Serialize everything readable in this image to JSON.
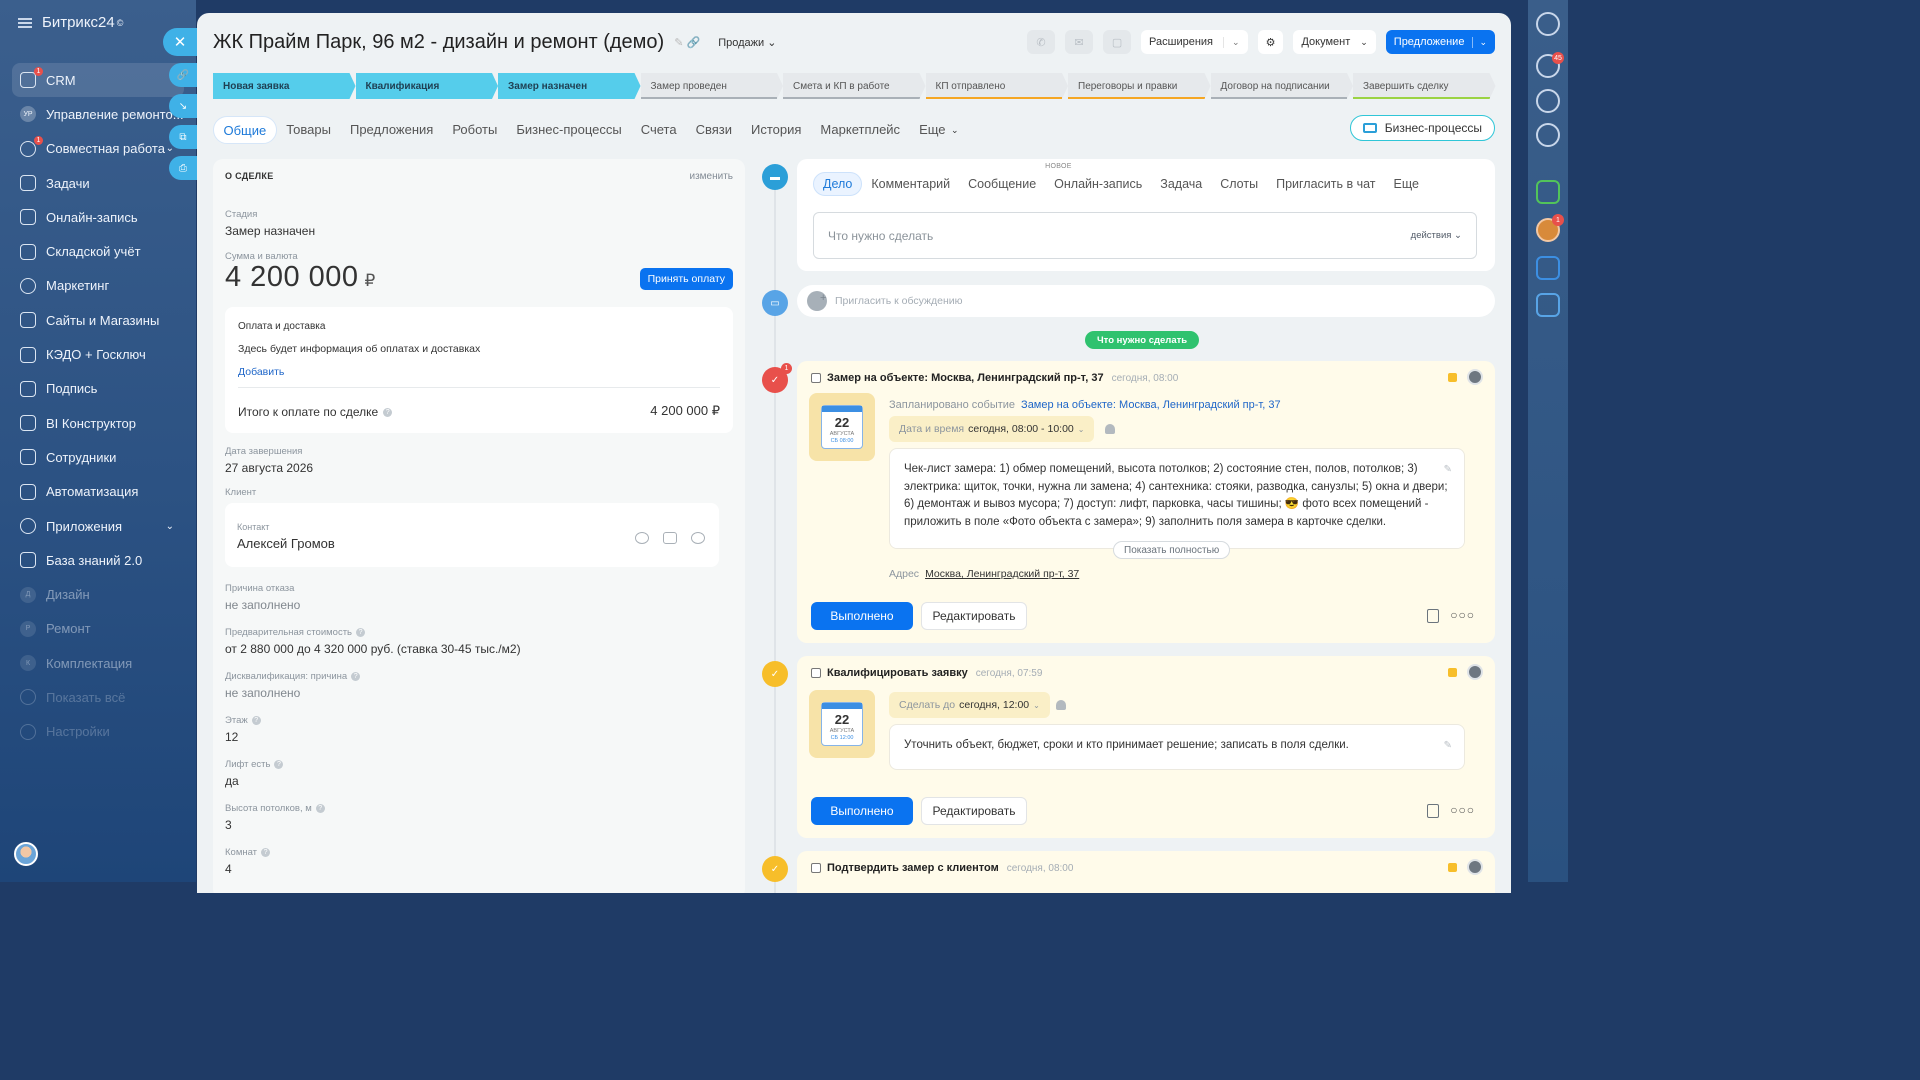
{
  "nav": {
    "brand": "Битрикс24",
    "brand_mark": "©",
    "items": [
      {
        "label": "CRM",
        "badge": "1"
      },
      {
        "label": "Управление ремонто..."
      },
      {
        "label": "Совместная работа",
        "badge": "1"
      },
      {
        "label": "Задачи"
      },
      {
        "label": "Онлайн-запись"
      },
      {
        "label": "Складской учёт"
      },
      {
        "label": "Маркетинг"
      },
      {
        "label": "Сайты и Магазины"
      },
      {
        "label": "КЭДО + Госключ"
      },
      {
        "label": "Подпись"
      },
      {
        "label": "BI Конструктор"
      },
      {
        "label": "Сотрудники"
      },
      {
        "label": "Автоматизация"
      },
      {
        "label": "Приложения"
      },
      {
        "label": "База знаний 2.0"
      },
      {
        "label": "Дизайн"
      },
      {
        "label": "Ремонт"
      },
      {
        "label": "Комплектация"
      },
      {
        "label": "Показать всё"
      },
      {
        "label": "Настройки"
      }
    ],
    "prefix_letters": [
      "УР",
      "Д",
      "Р",
      "К"
    ]
  },
  "right_badges": {
    "notifications": "45",
    "chat": "1"
  },
  "deal": {
    "title": "ЖК Прайм Парк, 96 м2 - дизайн и ремонт (демо)",
    "category": "Продажи",
    "tools": {
      "extensions": "Расширения",
      "document": "Документ",
      "proposal": "Предложение"
    }
  },
  "stages": [
    {
      "label": "Новая заявка",
      "state": "done"
    },
    {
      "label": "Квалификация",
      "state": "done"
    },
    {
      "label": "Замер назначен",
      "state": "done"
    },
    {
      "label": "Замер проведен",
      "state": "todo",
      "color": "#a9b0b7"
    },
    {
      "label": "Смета и КП в работе",
      "state": "todo",
      "color": "#a9b0b7"
    },
    {
      "label": "КП отправлено",
      "state": "todo",
      "color": "#f5a623"
    },
    {
      "label": "Переговоры и правки",
      "state": "todo",
      "color": "#f5a623"
    },
    {
      "label": "Договор на подписании",
      "state": "todo",
      "color": "#a9b0b7"
    },
    {
      "label": "Завершить сделку",
      "state": "todo",
      "color": "#9bd343"
    }
  ],
  "tabs": [
    "Общие",
    "Товары",
    "Предложения",
    "Роботы",
    "Бизнес-процессы",
    "Счета",
    "Связи",
    "История",
    "Маркетплейс",
    "Еще"
  ],
  "bp_button": "Бизнес-процессы",
  "about": {
    "header": "О СДЕЛКЕ",
    "edit": "изменить",
    "stage_label": "Стадия",
    "stage_value": "Замер назначен",
    "sum_label": "Сумма и валюта",
    "sum_value": "4 200 000",
    "currency": "₽",
    "pay_button": "Принять оплату",
    "payment": {
      "title": "Оплата и доставка",
      "desc": "Здесь будет информация об оплатах и доставках",
      "add": "Добавить",
      "total_label": "Итого к оплате по сделке",
      "total_value": "4 200 000 ₽"
    },
    "close_date_label": "Дата завершения",
    "close_date": "27 августа 2026",
    "client_label": "Клиент",
    "contact_label": "Контакт",
    "contact_name": "Алексей Громов",
    "fields": [
      {
        "label": "Причина отказа",
        "value": "не заполнено",
        "muted": true,
        "q": false
      },
      {
        "label": "Предварительная стоимость",
        "value": "от 2 880 000 до 4 320 000 руб. (ставка 30-45 тыс./м2)",
        "muted": false,
        "q": true
      },
      {
        "label": "Дисквалификация: причина",
        "value": "не заполнено",
        "muted": true,
        "q": true
      },
      {
        "label": "Этаж",
        "value": "12",
        "muted": false,
        "q": true
      },
      {
        "label": "Лифт есть",
        "value": "да",
        "muted": false,
        "q": true
      },
      {
        "label": "Высота потолков, м",
        "value": "3",
        "muted": false,
        "q": true
      },
      {
        "label": "Комнат",
        "value": "4",
        "muted": false,
        "q": true
      }
    ]
  },
  "editor": {
    "tabs": [
      "Дело",
      "Комментарий",
      "Сообщение",
      "Онлайн-запись",
      "Задача",
      "Слоты",
      "Пригласить в чат",
      "Еще"
    ],
    "new_badge": "НОВОЕ",
    "placeholder": "Что нужно сделать",
    "actions": "действия"
  },
  "invite_placeholder": "Пригласить к обсуждению",
  "todo_pill": "Что нужно сделать",
  "activities": [
    {
      "title": "Замер на объекте: Москва, Ленинградский пр-т, 37",
      "time": "сегодня, 08:00",
      "counter": "1",
      "cal_day": "22",
      "cal_month": "АВГУСТА",
      "cal_week": "СБ 08:00",
      "sched_label": "Запланировано событие",
      "sched_link": "Замер на объекте: Москва, Ленинградский пр-т, 37",
      "dt_label": "Дата и время",
      "dt_value": "сегодня, 08:00 - 10:00",
      "note": "Чек-лист замера: 1) обмер помещений, высота потолков; 2) состояние стен, полов, потолков; 3) электрика: щиток, точки, нужна ли замена; 4) сантехника: стояки, разводка, санузлы; 5) окна и двери; 6) демонтаж и вывоз мусора; 7) доступ: лифт, парковка, часы тишины; 😎 фото всех помещений - приложить в поле «Фото объекта с замера»; 9) заполнить поля замера в карточке сделки.",
      "show_full": "Показать полностью",
      "addr_label": "Адрес",
      "addr_value": "Москва, Ленинградский пр-т, 37",
      "done": "Выполнено",
      "edit": "Редактировать"
    },
    {
      "title": "Квалифицировать заявку",
      "time": "сегодня, 07:59",
      "cal_day": "22",
      "cal_month": "АВГУСТА",
      "cal_week": "СБ 12:00",
      "dt_label": "Сделать до",
      "dt_value": "сегодня, 12:00",
      "note": "Уточнить объект, бюджет, сроки и кто принимает решение; записать в поля сделки.",
      "done": "Выполнено",
      "edit": "Редактировать"
    },
    {
      "title": "Подтвердить замер с клиентом",
      "time": "сегодня, 08:00"
    }
  ]
}
